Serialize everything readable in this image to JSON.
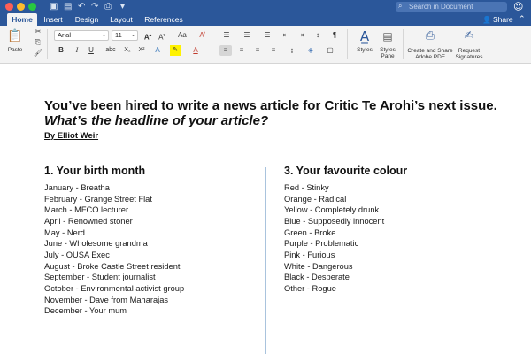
{
  "window": {
    "search_placeholder": "Search in Document"
  },
  "tabs": [
    {
      "label": "Home",
      "active": true
    },
    {
      "label": "Insert"
    },
    {
      "label": "Design"
    },
    {
      "label": "Layout"
    },
    {
      "label": "References"
    }
  ],
  "share_label": "Share",
  "ribbon": {
    "paste_label": "Paste",
    "font_name": "Arial",
    "font_size": "11",
    "styles_label": "Styles",
    "styles_pane_label": "Styles Pane",
    "create_pdf_label_1": "Create and Share",
    "create_pdf_label_2": "Adobe PDF",
    "request_sig_label_1": "Request",
    "request_sig_label_2": "Signatures",
    "bold": "B",
    "italic": "I",
    "underline": "U",
    "strikethrough": "abc",
    "subscript": "X₂",
    "superscript": "X²"
  },
  "document": {
    "headline": "You’ve been hired to write a news article for Critic Te Arohi’s next issue.",
    "subhead": "What’s the headline of your article?",
    "byline": "By Elliot Weir",
    "left_column": {
      "title": "1. Your birth month",
      "items": [
        "January - Breatha",
        "February - Grange Street Flat",
        "March - MFCO lecturer",
        "April - Renowned stoner",
        "May - Nerd",
        "June - Wholesome grandma",
        "July - OUSA Exec",
        "August - Broke Castle Street resident",
        "September - Student journalist",
        "October - Environmental activist group",
        "November - Dave from Maharajas",
        "December - Your mum"
      ]
    },
    "right_column": {
      "title": "3. Your favourite colour",
      "items": [
        "Red - Stinky",
        "Orange - Radical",
        "Yellow - Completely drunk",
        "Blue - Supposedly innocent",
        "Green - Broke",
        "Purple - Problematic",
        "Pink - Furious",
        "White - Dangerous",
        "Black - Desperate",
        "Other - Rogue"
      ]
    }
  },
  "colors": {
    "titlebar": "#2b579a",
    "ribbon": "#f3f3f3",
    "divider": "#a9c3dd"
  }
}
